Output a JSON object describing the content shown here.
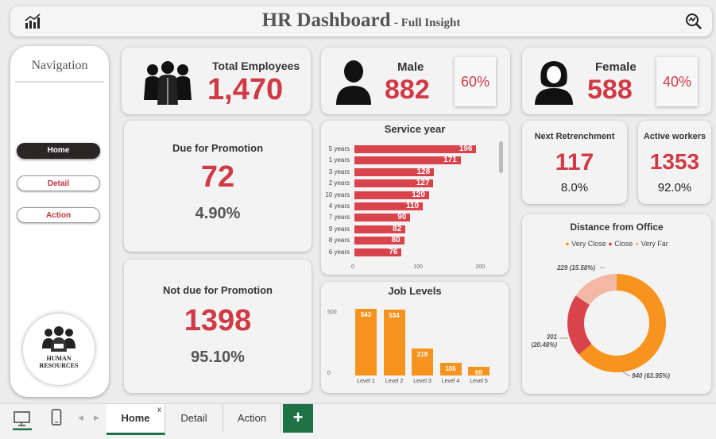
{
  "header": {
    "title": "HR Dashboard",
    "subtitle": "- Full Insight"
  },
  "nav": {
    "title": "Navigation",
    "home": "Home",
    "detail": "Detail",
    "action": "Action",
    "logo_line1": "HUMAN",
    "logo_line2": "RESOURCES"
  },
  "kpis": {
    "total_label": "Total Employees",
    "total_value": "1,470",
    "male_label": "Male",
    "male_value": "882",
    "male_pct": "60%",
    "female_label": "Female",
    "female_value": "588",
    "female_pct": "40%",
    "promo_label": "Due for Promotion",
    "promo_value": "72",
    "promo_pct": "4.90%",
    "notpromo_label": "Not due for Promotion",
    "notpromo_value": "1398",
    "notpromo_pct": "95.10%",
    "retrench_label": "Next Retrenchment",
    "retrench_value": "117",
    "retrench_pct": "8.0%",
    "active_label": "Active workers",
    "active_value": "1353",
    "active_pct": "92.0%"
  },
  "chart_data": [
    {
      "type": "bar",
      "orientation": "horizontal",
      "title": "Service year",
      "categories": [
        "5 years",
        "1 years",
        "3 years",
        "2 years",
        "10 years",
        "4 years",
        "7 years",
        "9 years",
        "8 years",
        "6 years"
      ],
      "values": [
        196,
        171,
        128,
        127,
        120,
        110,
        90,
        82,
        80,
        76
      ],
      "xticks": [
        "0",
        "100",
        "200"
      ],
      "xlim": [
        0,
        230
      ],
      "color": "#d9434c",
      "grid": false
    },
    {
      "type": "bar",
      "orientation": "vertical",
      "title": "Job Levels",
      "categories": [
        "Level 1",
        "Level 2",
        "Level 3",
        "Level 4",
        "Level 5"
      ],
      "values": [
        543,
        534,
        218,
        106,
        69
      ],
      "yticks": [
        "0",
        "500"
      ],
      "ylim": [
        0,
        620
      ],
      "color": "#f7941d",
      "grid": false
    },
    {
      "type": "pie",
      "style": "donut",
      "title": "Distance from Office",
      "legend_position": "top",
      "series": [
        {
          "name": "Very Close",
          "value": 940,
          "label": "940 (63.95%)",
          "color": "#f7941d"
        },
        {
          "name": "Close",
          "value": 301,
          "label": "301 (20.48%)",
          "color": "#d9434c"
        },
        {
          "name": "Very Far",
          "value": 229,
          "label": "229 (15.58%)",
          "color": "#f2b8a3"
        }
      ]
    }
  ],
  "tabs": {
    "home": "Home",
    "detail": "Detail",
    "action": "Action",
    "close": "x",
    "add": "+"
  },
  "colors": {
    "accent_red": "#d03a45",
    "bar_red": "#d9434c",
    "bar_orange": "#f7941d",
    "tab_green": "#1e7346"
  }
}
